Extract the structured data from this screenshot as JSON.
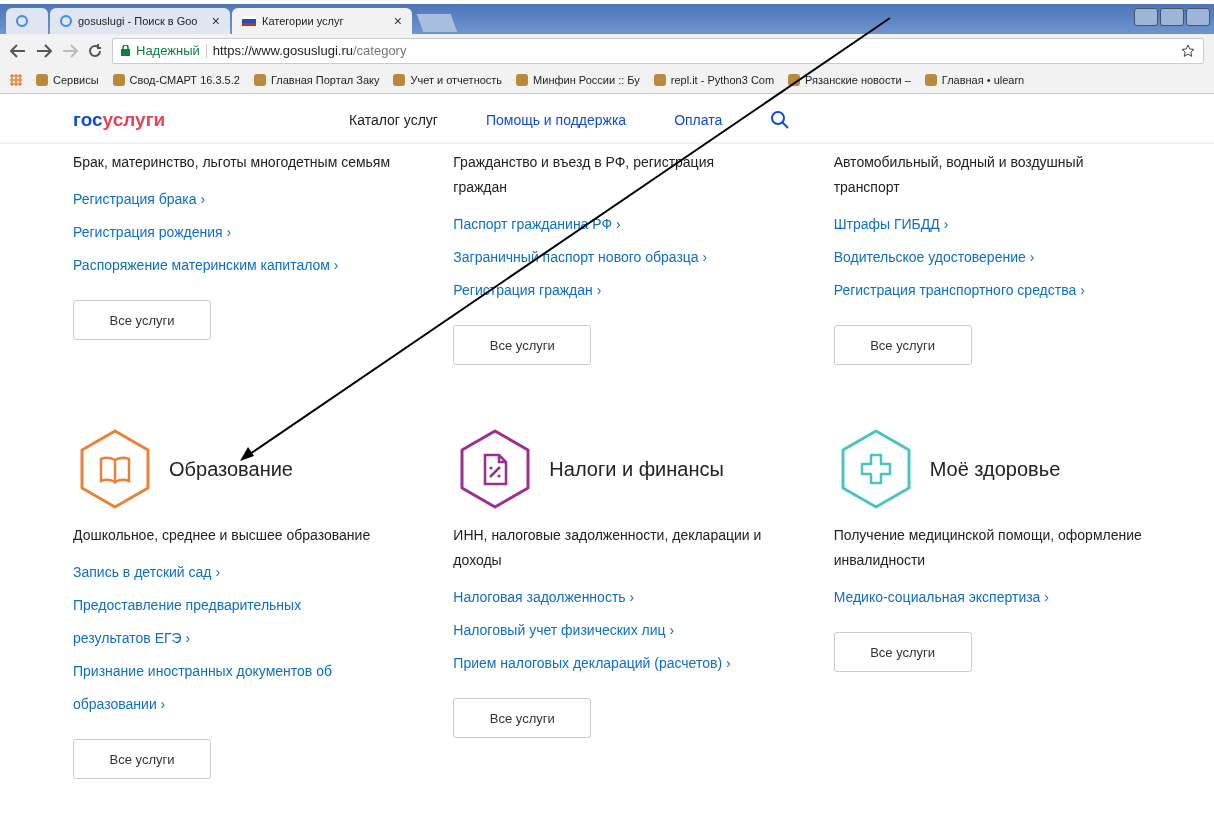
{
  "browser": {
    "tabs": [
      {
        "selected": false
      },
      {
        "title": "gosuslugi - Поиск в Goo",
        "selected": false
      },
      {
        "title": "Категории услуг",
        "selected": true
      }
    ],
    "close_glyph": "×",
    "security_label": "Надежный",
    "url_host": "https://www.gosuslugi.ru",
    "url_path": "/category",
    "bookmarks": [
      "Сервисы",
      "Свод-СМАРТ 16.3.5.2",
      "Главная Портал Заку",
      "Учет и отчетность",
      "Минфин России :: Бу",
      "repl.it - Python3 Com",
      "Рязанские новости –",
      "Главная • ulearn"
    ]
  },
  "site": {
    "logo_part1": "гос",
    "logo_part2": "услуги",
    "nav": [
      {
        "label": "Каталог услуг",
        "selected": true
      },
      {
        "label": "Помощь и поддержка",
        "selected": false
      },
      {
        "label": "Оплата",
        "selected": false
      }
    ]
  },
  "sections": [
    {
      "kind": "none",
      "description": "Брак, материнство, льготы многодетным семьям",
      "links": [
        "Регистрация брака",
        "Регистрация рождения",
        "Распоряжение материнским капиталом"
      ],
      "button": "Все услуги"
    },
    {
      "kind": "none",
      "description": "Гражданство и въезд в РФ, регистрация граждан",
      "links": [
        "Паспорт гражданина РФ",
        "Заграничный паспорт нового образца",
        "Регистрация граждан"
      ],
      "button": "Все услуги"
    },
    {
      "kind": "none",
      "description": "Автомобильный, водный и воздушный транспорт",
      "links": [
        "Штрафы ГИБДД",
        "Водительское удостоверение",
        "Регистрация транспортного средства"
      ],
      "button": "Все услуги"
    },
    {
      "kind": "book",
      "color": "#e8823a",
      "title": "Образование",
      "description": "Дошкольное, среднее и высшее образование",
      "links": [
        "Запись в детский сад",
        "Предоставление предварительных результатов ЕГЭ",
        "Признание иностранных документов об образовании"
      ],
      "button": "Все услуги"
    },
    {
      "kind": "tax",
      "color": "#9b2f8f",
      "title": "Налоги и финансы",
      "description": "ИНН, налоговые задолженности, декларации и доходы",
      "links": [
        "Налоговая задолженность",
        "Налоговый учет физических лиц",
        "Прием налоговых деклараций (расчетов)"
      ],
      "button": "Все услуги"
    },
    {
      "kind": "health",
      "color": "#4cc3c3",
      "title": "Моё здоровье",
      "description": "Получение медицинской помощи, оформление инвалидности",
      "links": [
        "Медико-социальная экспертиза"
      ],
      "button": "Все услуги"
    }
  ],
  "link_chevron": "›"
}
